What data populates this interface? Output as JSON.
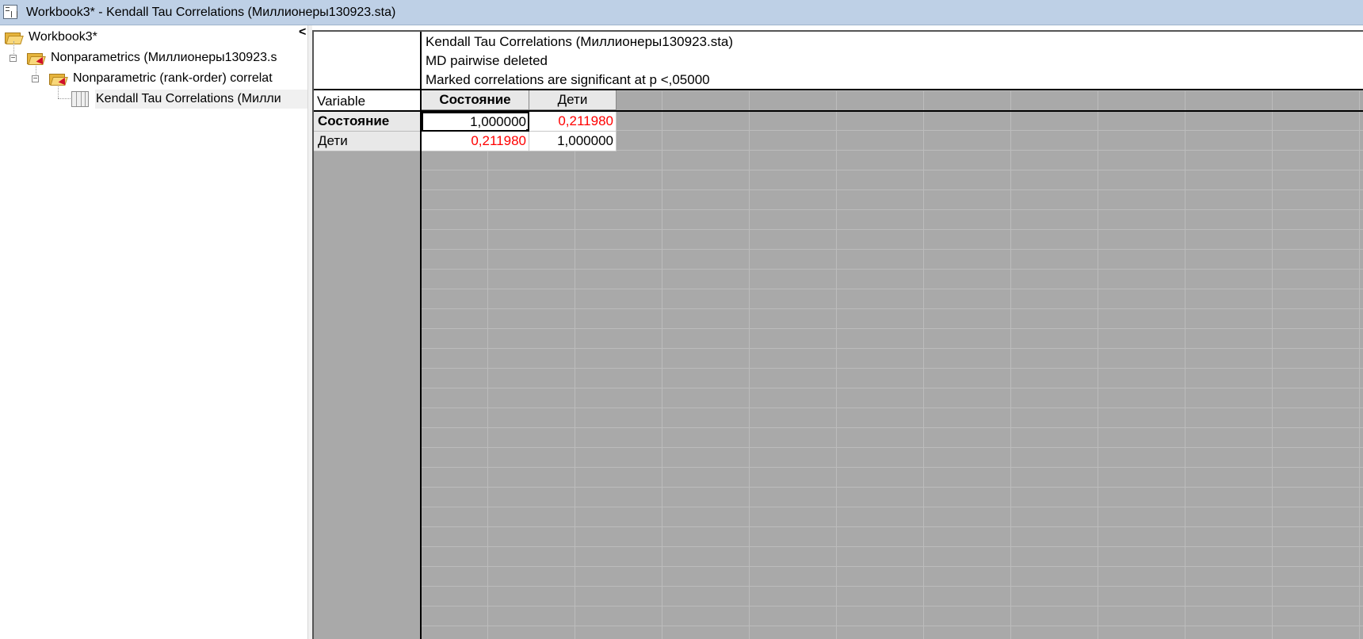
{
  "window": {
    "title": "Workbook3* - Kendall Tau Correlations (Миллионеры130923.sta)"
  },
  "tree": {
    "collapse_glyph": "<",
    "items": [
      {
        "label": "Workbook3*",
        "icon": "open-folder-icon"
      },
      {
        "label": "Nonparametrics (Миллионеры130923.s",
        "icon": "folder-arrow-icon",
        "expander": "−"
      },
      {
        "label": "Nonparametric (rank-order) correlat",
        "icon": "folder-arrow-icon",
        "expander": "−"
      },
      {
        "label": "Kendall Tau Correlations (Милли",
        "icon": "spreadsheet-icon",
        "selected": true
      }
    ]
  },
  "spreadsheet": {
    "header_lines": [
      "Kendall Tau Correlations (Миллионеры130923.sta)",
      "MD pairwise deleted",
      "Marked correlations are significant at p <,05000"
    ],
    "corner_label": "Variable",
    "columns": [
      "Состояние",
      "Дети"
    ],
    "rows": [
      {
        "label": "Состояние",
        "values": [
          "1,000000",
          "0,211980"
        ],
        "significant": [
          false,
          true
        ]
      },
      {
        "label": "Дети",
        "values": [
          "0,211980",
          "1,000000"
        ],
        "significant": [
          true,
          false
        ]
      }
    ],
    "significant_color": "#ff0000"
  }
}
